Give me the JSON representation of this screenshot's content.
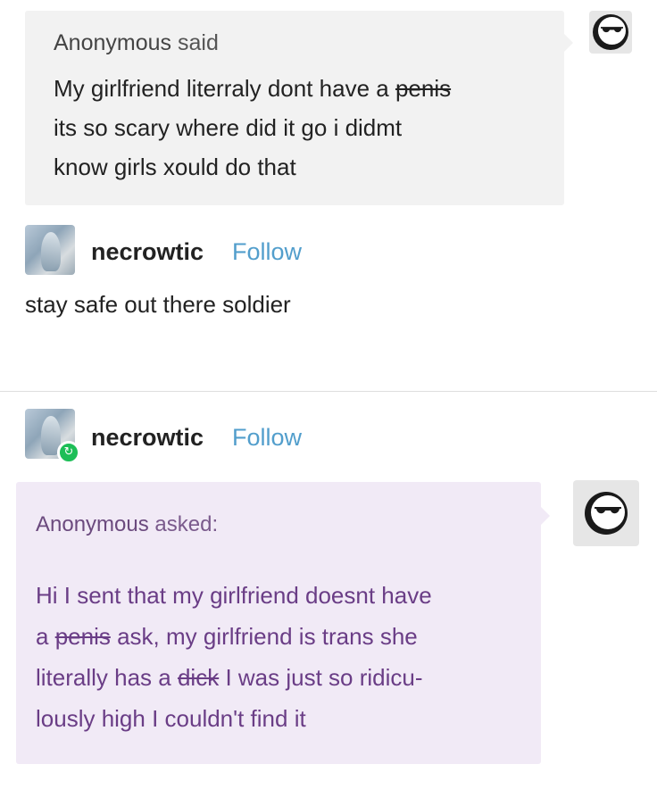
{
  "post1": {
    "asker_name": "Anonymous",
    "asker_verb": "said",
    "message_lines": [
      {
        "before": "My girlfriend literraly dont have a ",
        "struck": "penis",
        "after": ""
      },
      {
        "before": "its so scary where did it go i didmt",
        "struck": "",
        "after": ""
      },
      {
        "before": "know girls xould do that",
        "struck": "",
        "after": ""
      }
    ],
    "avatar_icon": "sunglasses-face-icon"
  },
  "reply1": {
    "username": "necrowtic",
    "follow_label": "Follow",
    "text": "stay safe out there soldier"
  },
  "post2": {
    "username": "necrowtic",
    "follow_label": "Follow",
    "reblog_icon": "reblog-icon",
    "asker_name": "Anonymous",
    "asker_verb": "asked:",
    "message_lines": [
      {
        "before": "Hi I sent that my girlfriend doesnt have",
        "struck": "",
        "after": ""
      },
      {
        "before": "a ",
        "struck": "penis",
        "after": " ask, my girlfriend is trans she"
      },
      {
        "before": "literally has a ",
        "struck": "dick",
        "after": " I was just so ridicu-"
      },
      {
        "before": "lously high I couldn't find it",
        "struck": "",
        "after": ""
      }
    ],
    "avatar_icon": "sunglasses-face-icon"
  },
  "colors": {
    "follow": "#529ecc",
    "ask_bubble": "#f1eaf6",
    "ask_text": "#6a3d86",
    "reblog_badge": "#1dbe57"
  }
}
